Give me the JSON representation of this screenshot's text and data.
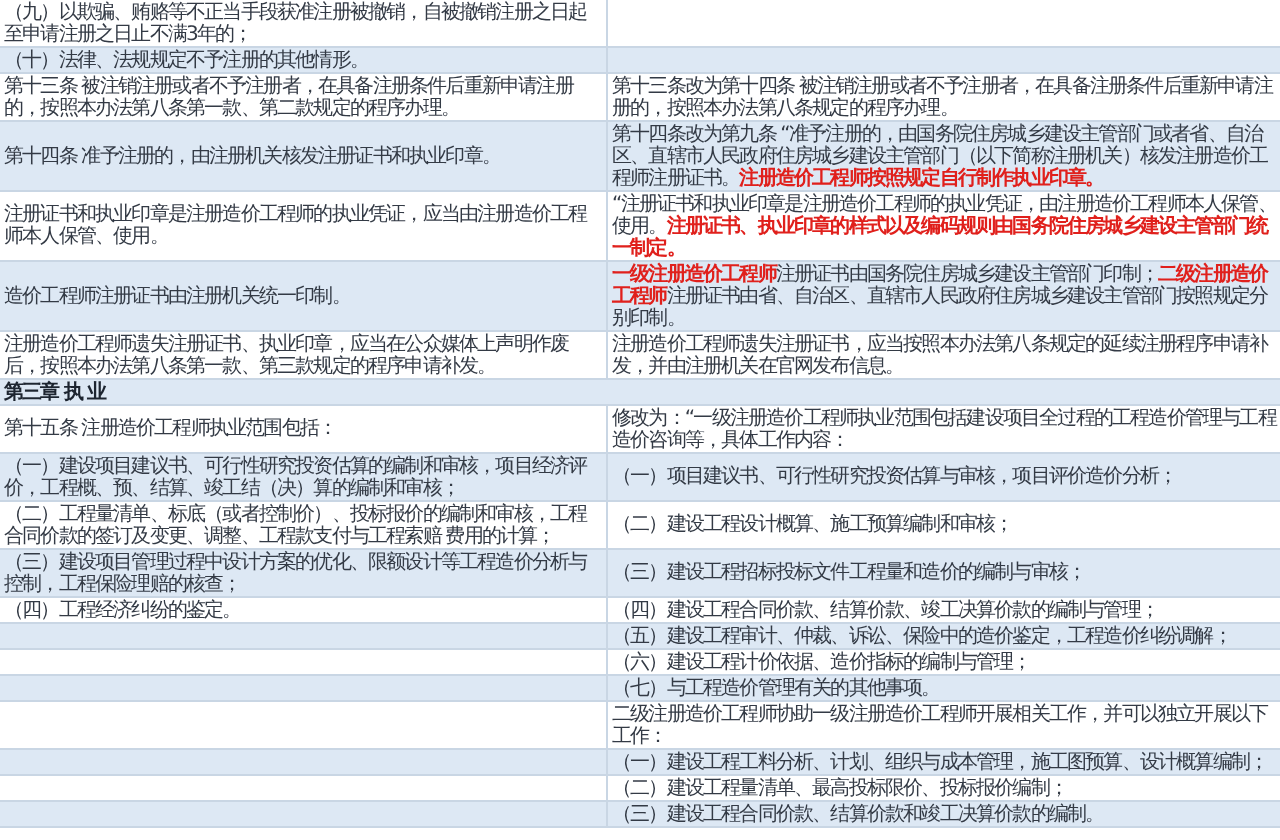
{
  "table": {
    "rows": [
      {
        "kind": "pair",
        "left": "（九）以欺骗、贿赂等不正当手段获准注册被撤销，自被撤销注册之日起至申请注册之日止不满3年的；"
      },
      {
        "kind": "pair",
        "left": "（十）法律、法规规定不予注册的其他情形。"
      },
      {
        "kind": "pair",
        "left": "第十三条 被注销注册或者不予注册者，在具备注册条件后重新申请注册的，按照本办法第八条第一款、第二款规定的程序办理。",
        "right": "第十三条改为第十四条 被注销注册或者不予注册者，在具备注册条件后重新申请注册的，按照本办法第八条规定的程序办理。"
      },
      {
        "kind": "pair",
        "left": "第十四条 准予注册的，由注册机关核发注册证书和执业印章。",
        "right": "第十四条改为第九条 “准予注册的，由国务院住房城乡建设主管部门或者省、自治区、直辖市人民政府住房城乡建设主管部门（以下简称注册机关）核发注册造价工程师注册证书。**注册造价工程师按照规定自行制作执业印章。**"
      },
      {
        "kind": "pair",
        "left": "注册证书和执业印章是注册造价工程师的执业凭证，应当由注册造价工程师本人保管、使用。",
        "right": "“注册证书和执业印章是注册造价工程师的执业凭证，由注册造价工程师本人保管、使用。**注册证书、执业印章的样式以及编码规则由国务院住房城乡建设主管部门统一制定。**"
      },
      {
        "kind": "pair",
        "left": "造价工程师注册证书由注册机关统一印制。",
        "right": "**一级注册造价工程师**注册证书由国务院住房城乡建设主管部门印制；**二级注册造价工程师**注册证书由省、自治区、直辖市人民政府住房城乡建设主管部门按照规定分别印制。"
      },
      {
        "kind": "pair",
        "left": "注册造价工程师遗失注册证书、执业印章，应当在公众媒体上声明作废后，按照本办法第八条第一款、第三款规定的程序申请补发。",
        "right": "注册造价工程师遗失注册证书，应当按照本办法第八条规定的延续注册程序申请补发，并由注册机关在官网发布信息。"
      },
      {
        "kind": "chapter",
        "text": "第三章 执 业"
      },
      {
        "kind": "pair",
        "left": "第十五条 注册造价工程师执业范围包括：",
        "right": "修改为：“一级注册造价工程师执业范围包括建设项目全过程的工程造价管理与工程造价咨询等，具体工作内容："
      },
      {
        "kind": "pair",
        "left": "（一）建设项目建议书、可行性研究投资估算的编制和审核，项目经济评价，工程概、预、结算、竣工结（决）算的编制和审核；",
        "right": "（一）项目建议书、可行性研究投资估算与审核，项目评价造价分析；"
      },
      {
        "kind": "pair",
        "left": "（二）工程量清单、标底（或者控制价）、投标报价的编制和审核，工程合同价款的签订及变更、调整、工程款支付与工程索赔 费用的计算；",
        "right": "（二）建设工程设计概算、施工预算编制和审核；"
      },
      {
        "kind": "pair",
        "left": "（三）建设项目管理过程中设计方案的优化、限额设计等工程造价分析与控制，工程保险理赔的核查；",
        "right": "（三）建设工程招标投标文件工程量和造价的编制与审核；"
      },
      {
        "kind": "pair",
        "left": "（四）工程经济纠纷的鉴定。",
        "right": "（四）建设工程合同价款、结算价款、竣工决算价款的编制与管理；"
      },
      {
        "kind": "pair",
        "right": "（五）建设工程审计、仲裁、诉讼、保险中的造价鉴定，工程造价纠纷调解；"
      },
      {
        "kind": "pair",
        "right": "（六）建设工程计价依据、造价指标的编制与管理；"
      },
      {
        "kind": "pair",
        "right": "（七）与工程造价管理有关的其他事项。"
      },
      {
        "kind": "pair",
        "right": "二级注册造价工程师协助一级注册造价工程师开展相关工作，并可以独立开展以下工作："
      },
      {
        "kind": "pair",
        "right": "（一）建设工程工料分析、计划、组织与成本管理，施工图预算、设计概算编制；"
      },
      {
        "kind": "pair",
        "right": "（二）建设工程量清单、最高投标限价、投标报价编制；"
      },
      {
        "kind": "pair",
        "right": "（三）建设工程合同价款、结算价款和竣工决算价款的编制。"
      }
    ]
  }
}
